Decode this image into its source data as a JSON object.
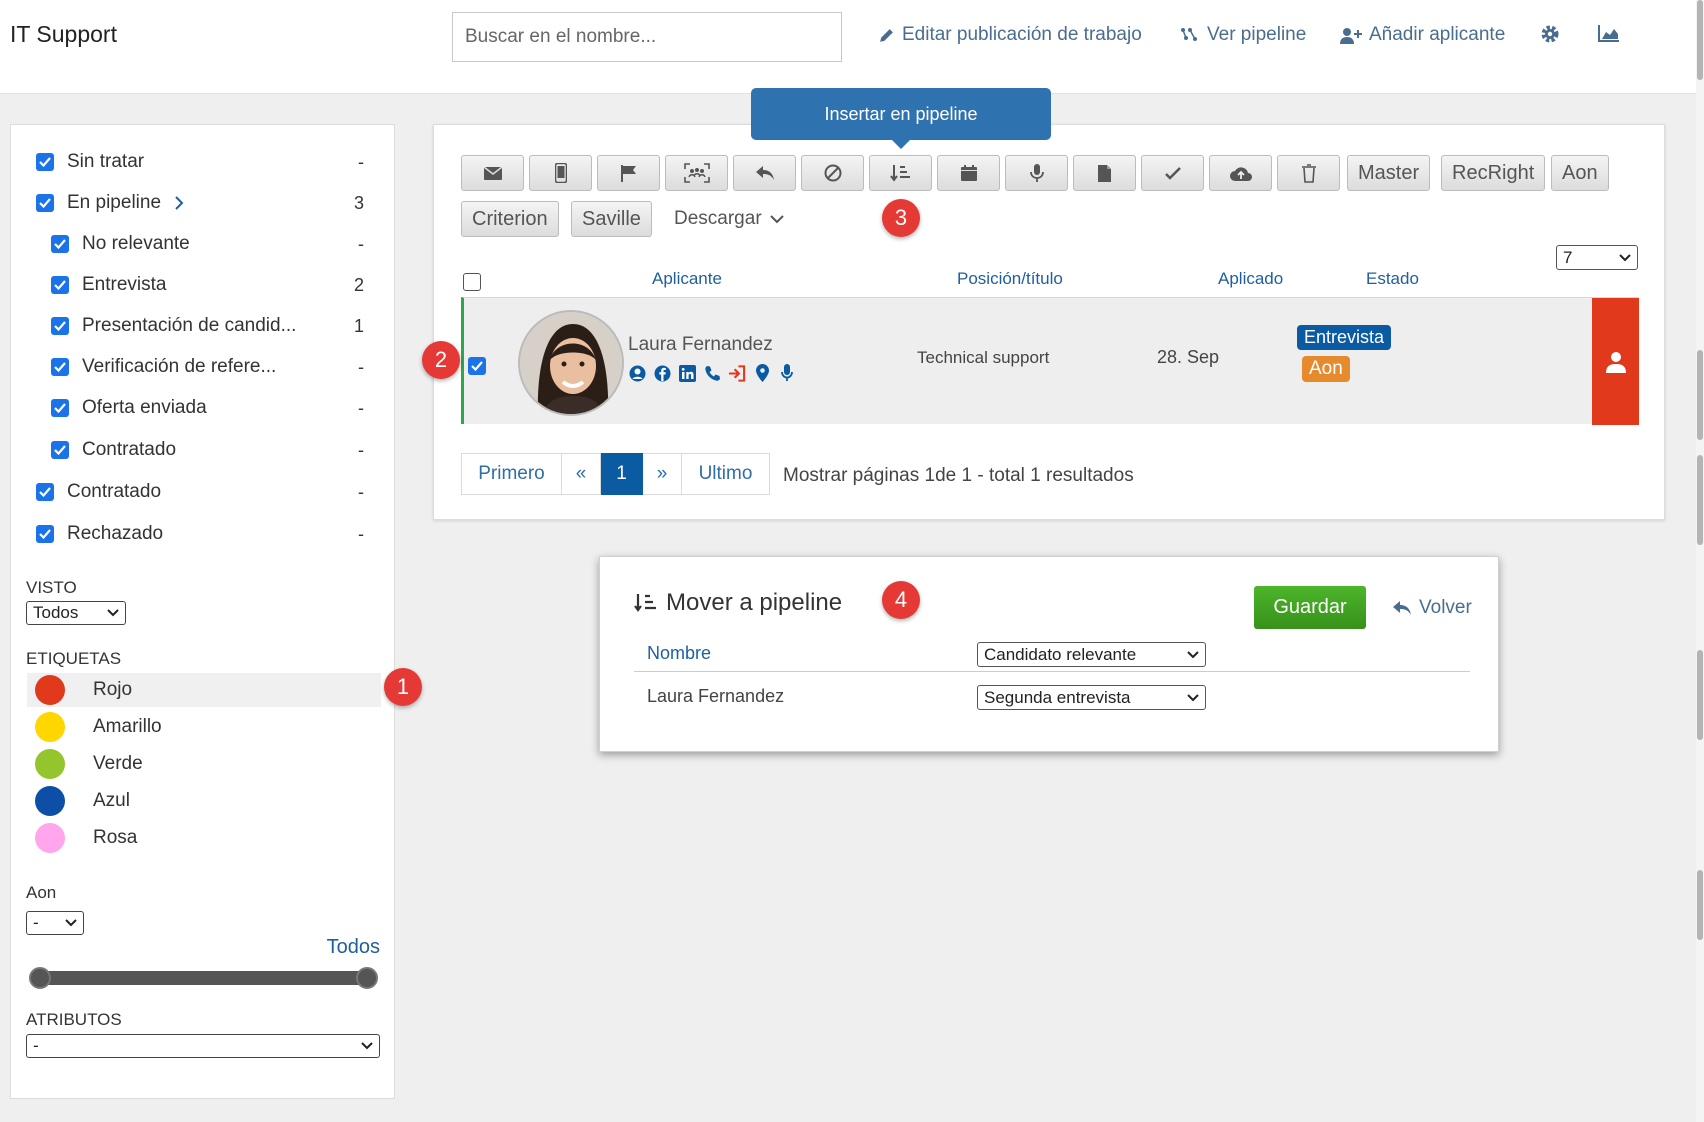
{
  "header": {
    "title": "IT Support",
    "search_placeholder": "Buscar en el nombre...",
    "nav": {
      "edit_job": "Editar publicación de trabajo",
      "view_pipeline": "Ver pipeline",
      "add_applicant": "Añadir aplicante"
    }
  },
  "filters": {
    "items": [
      {
        "label": "Sin tratar",
        "count": "-"
      },
      {
        "label": "En pipeline",
        "count": "3"
      },
      {
        "label": "No relevante",
        "count": "-"
      },
      {
        "label": "Entrevista",
        "count": "2"
      },
      {
        "label": "Presentación de candid...",
        "count": "1"
      },
      {
        "label": "Verificación de refere...",
        "count": "-"
      },
      {
        "label": "Oferta enviada",
        "count": "-"
      },
      {
        "label": "Contratado",
        "count": "-"
      },
      {
        "label": "Contratado",
        "count": "-"
      },
      {
        "label": "Rechazado",
        "count": "-"
      }
    ],
    "visto": {
      "label": "VISTO",
      "value": "Todos"
    },
    "etiquetas": {
      "label": "ETIQUETAS",
      "tags": [
        {
          "label": "Rojo",
          "color": "#e0391b"
        },
        {
          "label": "Amarillo",
          "color": "#ffd600"
        },
        {
          "label": "Verde",
          "color": "#94c52c"
        },
        {
          "label": "Azul",
          "color": "#0d4ea6"
        },
        {
          "label": "Rosa",
          "color": "#ffa6ec"
        }
      ]
    },
    "aon": {
      "label": "Aon",
      "value": "-",
      "range_link": "Todos"
    },
    "atributos": {
      "label": "ATRIBUTOS",
      "value": "-"
    }
  },
  "toolbar": {
    "tooltip": "Insertar en pipeline",
    "icon_buttons": [
      "envelope-icon",
      "mobile-icon",
      "flag-icon",
      "group-scan-icon",
      "reply-icon",
      "ban-icon",
      "sort-pipeline-icon",
      "calendar-icon",
      "microphone-icon",
      "document-icon",
      "check-icon",
      "cloud-upload-icon",
      "trash-icon"
    ],
    "text_buttons": [
      "Master",
      "RecRight",
      "Aon",
      "Criterion",
      "Saville"
    ],
    "download": "Descargar"
  },
  "table": {
    "page_size": "7",
    "columns": {
      "applicant": "Aplicante",
      "position": "Posición/título",
      "applied": "Aplicado",
      "status": "Estado"
    },
    "rows": [
      {
        "name": "Laura Fernandez",
        "position": "Technical support",
        "applied": "28. Sep",
        "status_primary": "Entrevista",
        "status_secondary": "Aon",
        "contact_icons": [
          "user-circle-icon",
          "facebook-icon",
          "linkedin-icon",
          "phone-icon",
          "sign-in-icon",
          "map-marker-icon",
          "microphone-icon"
        ]
      }
    ]
  },
  "pagination": {
    "first": "Primero",
    "prev": "«",
    "current": "1",
    "next": "»",
    "last": "Ultimo",
    "summary_prefix": "Mostrar páginas ",
    "page": "1",
    "summary_mid": "de ",
    "of": "1",
    "summary_total": " - total ",
    "total": "1",
    "summary_suffix": " resultados"
  },
  "move_panel": {
    "title": "Mover a pipeline",
    "save": "Guardar",
    "back": "Volver",
    "column_name": "Nombre",
    "header_select": "Candidato relevante",
    "row_name": "Laura Fernandez",
    "row_select": "Segunda entrevista"
  },
  "badges": [
    "1",
    "2",
    "3",
    "4"
  ],
  "colors": {
    "link": "#1f5f9e",
    "primary_status": "#0b5ba3",
    "aon_status": "#e68a2e",
    "danger": "#e0391b",
    "save": "#3e9a1f"
  }
}
